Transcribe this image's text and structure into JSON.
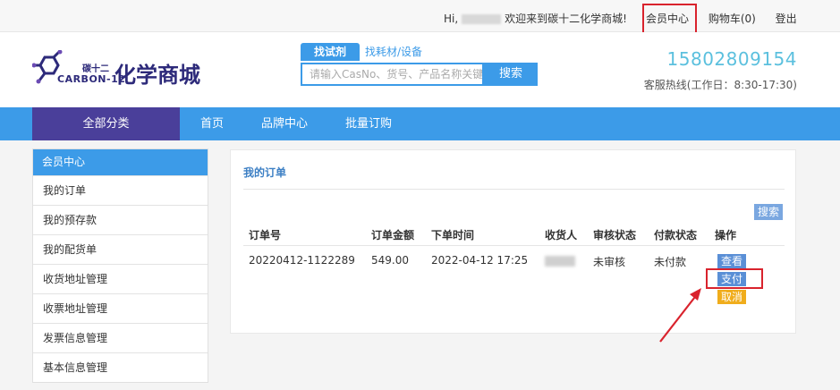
{
  "topbar": {
    "greeting_prefix": "Hi,",
    "greeting_suffix": "欢迎来到碳十二化学商城!",
    "member_center": "会员中心",
    "cart": "购物车(0)",
    "logout": "登出"
  },
  "header": {
    "logo_small": "碳十二",
    "logo_en": "CARBON-12",
    "logo_big": "化学商城",
    "search_tab_active": "找试剂",
    "search_tab_other": "找耗材/设备",
    "search_placeholder": "请输入CasNo、货号、产品名称关键",
    "search_button": "搜索",
    "phone": "15802809154",
    "hotline_desc": "客服热线(工作日：8:30-17:30)"
  },
  "nav": {
    "all": "全部分类",
    "items": [
      "首页",
      "品牌中心",
      "批量订购"
    ]
  },
  "sidebar": {
    "head": "会员中心",
    "items": [
      "我的订单",
      "我的预存款",
      "我的配货单",
      "收货地址管理",
      "收票地址管理",
      "发票信息管理",
      "基本信息管理"
    ]
  },
  "orders": {
    "title": "我的订单",
    "search_button": "搜索",
    "columns": [
      "订单号",
      "订单金额",
      "下单时间",
      "收货人",
      "审核状态",
      "付款状态",
      "操作"
    ],
    "rows": [
      {
        "order_no": "20220412-1122289",
        "amount": "549.00",
        "time": "2022-04-12 17:25",
        "audit": "未审核",
        "pay_status": "未付款",
        "actions": [
          "查看",
          "支付",
          "取消"
        ]
      }
    ]
  },
  "colors": {
    "primary": "#3c9be8",
    "nav_dark": "#4a3f9a",
    "highlight": "#d9232d",
    "cancel": "#f0ad1c"
  }
}
